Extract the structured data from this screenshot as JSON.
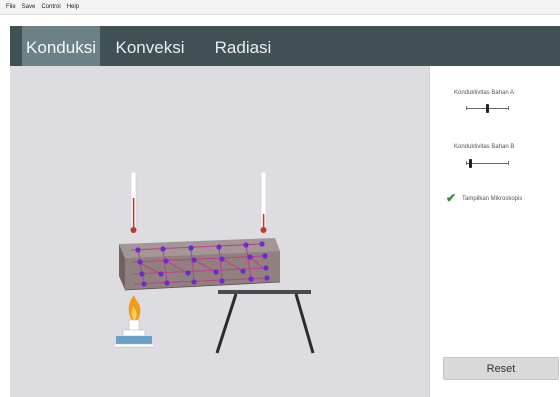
{
  "menu": {
    "items": [
      "File",
      "Save",
      "Control",
      "Help"
    ]
  },
  "tabs": [
    {
      "label": "Konduksi",
      "active": true
    },
    {
      "label": "Konveksi",
      "active": false
    },
    {
      "label": "Radiasi",
      "active": false
    }
  ],
  "controls": {
    "slider_a": {
      "label": "Konduktivitas Bahan A",
      "value": 0.5
    },
    "slider_b": {
      "label": "Konduktivitas Bahan B",
      "value": 0.1
    },
    "checkbox": {
      "label": "Tampilkan Mikroskopis",
      "checked": true
    },
    "reset_label": "Reset"
  },
  "colors": {
    "tab_bar": "#415055",
    "tab_active": "#6d8088",
    "sim_bg": "#dcdce1",
    "thermometer_bulb": "#c0392b",
    "particles": "#6a2bd1",
    "bonds": "#c0408f",
    "bar": "#8b7a78",
    "flame": "#f29a1e",
    "burner": "#6aa0c8",
    "check": "#2f8a3a"
  },
  "icons": [
    "thermometer-left-icon",
    "thermometer-right-icon",
    "flame-icon",
    "burner-icon",
    "table-icon",
    "checkmark-icon"
  ]
}
